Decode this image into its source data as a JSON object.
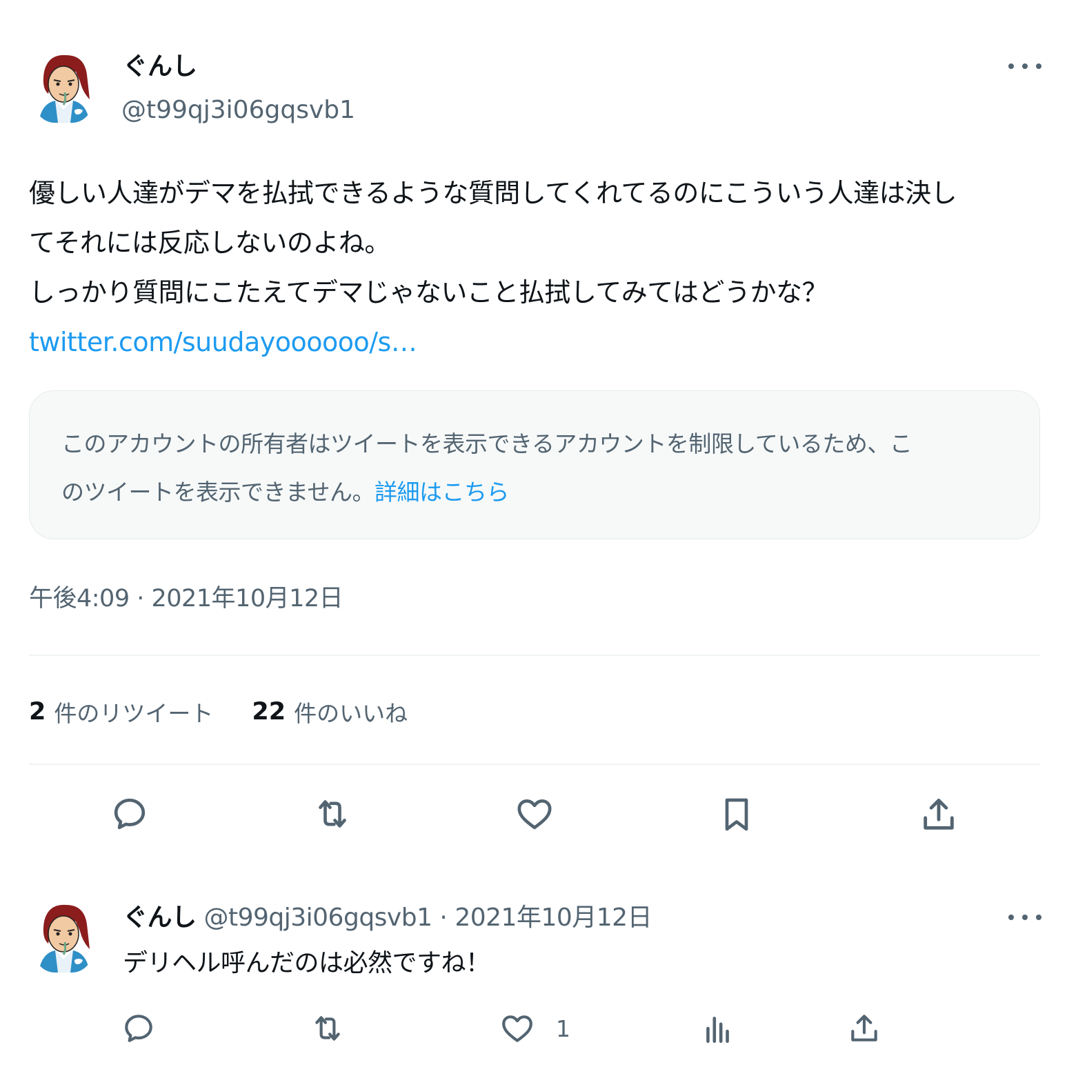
{
  "tweet": {
    "author": {
      "display_name": "ぐんし",
      "handle": "@t99qj3i06gqsvb1",
      "avatar_icon": "avatar-samurai-illustration"
    },
    "more_icon": "more-horizontal-icon",
    "text_lines": [
      "優しい人達がデマを払拭できるような質問してくれてるのにこういう人達は決し",
      "てそれには反応しないのよね。",
      "しっかり質問にこたえてデマじゃないこと払拭してみてはどうかな？"
    ],
    "link_text": "twitter.com/suudayoooooo/s…",
    "quoted_notice": {
      "line1": "このアカウントの所有者はツイートを表示できるアカウントを制限しているため、こ",
      "line2": "のツイートを表示できません。",
      "link_text": "詳細はこちら"
    },
    "timestamp": "午後4:09 · 2021年10月12日",
    "stats": {
      "retweets_count": "2",
      "retweets_label": "件のリツイート",
      "likes_count": "22",
      "likes_label": "件のいいね"
    },
    "actions": {
      "reply_icon": "reply-icon",
      "retweet_icon": "retweet-icon",
      "like_icon": "heart-icon",
      "bookmark_icon": "bookmark-icon",
      "share_icon": "share-icon"
    }
  },
  "reply": {
    "author": {
      "display_name": "ぐんし",
      "handle": "@t99qj3i06gqsvb1",
      "avatar_icon": "avatar-samurai-illustration"
    },
    "separator": " · ",
    "date": "2021年10月12日",
    "text": "デリヘル呼んだのは必然ですね！",
    "like_count": "1",
    "actions": {
      "reply_icon": "reply-icon",
      "retweet_icon": "retweet-icon",
      "like_icon": "heart-icon",
      "views_icon": "analytics-icon",
      "share_icon": "share-icon"
    }
  },
  "colors": {
    "text": "#0f1419",
    "secondary": "#536471",
    "link": "#1d9bf0",
    "divider": "#eff3f4",
    "notice_bg": "#f7f9f9"
  }
}
